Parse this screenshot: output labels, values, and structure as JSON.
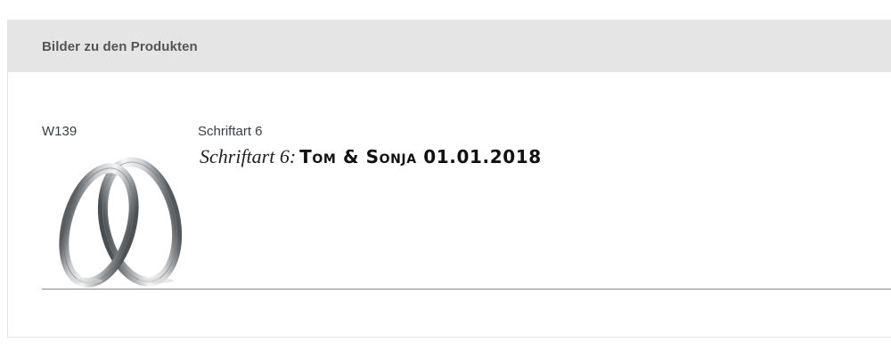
{
  "panel": {
    "title": "Bilder zu den Produkten"
  },
  "product": {
    "sku": "W139",
    "image_icon": "wedding-rings-image",
    "font_label": "Schriftart 6",
    "engraving_prefix": "Schriftart 6:",
    "engraving_text": "Tom & Sonja 01.01.2018"
  }
}
